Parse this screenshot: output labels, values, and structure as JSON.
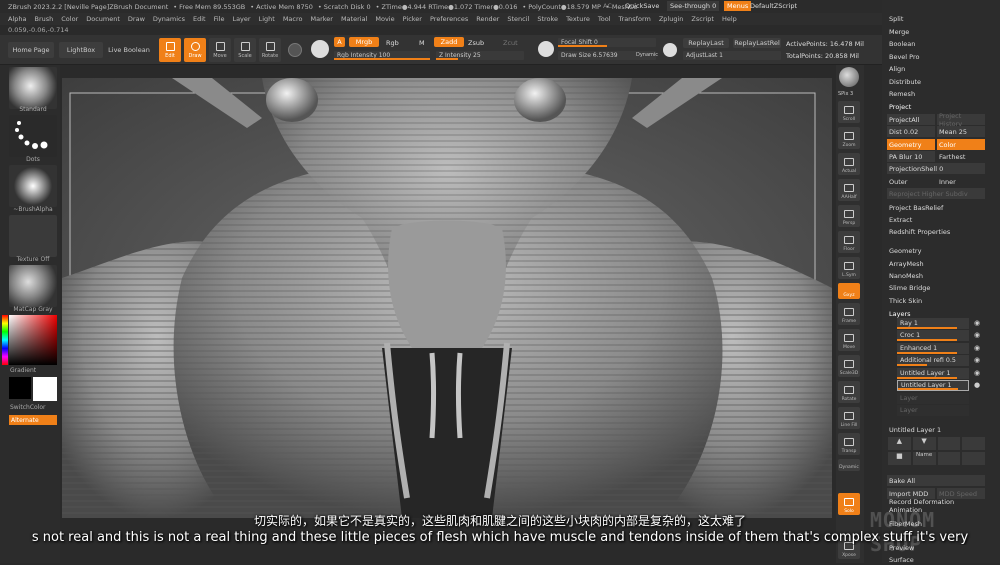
{
  "titlebar": {
    "items": [
      "ZBrush 2023.2.2 [Neville Page]ZBrush Document",
      "• Free Mem 89.553GB",
      "• Active Mem 8750",
      "• Scratch Disk 0",
      "• ZTime●4.944 RTime●1.072 Timer●0.016",
      "• PolyCount●18.579 MP",
      "• MeshCo"
    ],
    "ac": "AC",
    "quicksave": "QuickSave",
    "seethrough": "See-through",
    "seethrough_val": "0",
    "menus": "Menus",
    "script": "DefaultZScript"
  },
  "menubar": [
    "Alpha",
    "Brush",
    "Color",
    "Document",
    "Draw",
    "Dynamics",
    "Edit",
    "File",
    "Layer",
    "Light",
    "Macro",
    "Marker",
    "Material",
    "Movie",
    "Picker",
    "Preferences",
    "Render",
    "Stencil",
    "Stroke",
    "Texture",
    "Tool",
    "Transform",
    "Zplugin",
    "Zscript",
    "Help"
  ],
  "coords": "0.059,-0.06,-0.714",
  "toolbar": {
    "home": "Home Page",
    "lightbox": "LightBox",
    "liveboolean": "Live Boolean",
    "edit": "Edit",
    "draw": "Draw",
    "move": "Move",
    "scale": "Scale",
    "rotate": "Rotate",
    "a": "A",
    "mrgb": "Mrgb",
    "rgb": "Rgb",
    "m": "M",
    "zadd": "Zadd",
    "zsub": "Zsub",
    "zcut": "Zcut",
    "rgb_int": "Rgb Intensity 100",
    "z_int": "Z Intensity 25",
    "focal": "Focal Shift 0",
    "drawsize": "Draw Size 6.57639",
    "dynamic": "Dynamic",
    "replaylast": "ReplayLast",
    "replaylastrel": "ReplayLastRel",
    "adjustlast": "AdjustLast 1",
    "activepoints": "ActivePoints: 16.478 Mil",
    "totalpoints": "TotalPoints: 20.858 Mil"
  },
  "leftpanel": {
    "standard": "Standard",
    "dots": "Dots",
    "brushalpha": "~BrushAlpha",
    "textureoff": "Texture Off",
    "matcap": "MatCap Gray",
    "gradient": "Gradient",
    "switchcolor": "SwitchColor",
    "alternate": "Alternate"
  },
  "shelf": [
    "SPix 3",
    "Scroll",
    "Zoom",
    "Actual",
    "AAHalf",
    "Persp",
    "Floor",
    "L.Sym",
    "Gxyz",
    "Frame",
    "Move",
    "Scale3D",
    "Rotate",
    "Line Fill",
    "Transp",
    "Dynamic",
    "Solo",
    "Xpose"
  ],
  "tray": {
    "top": [
      "Split",
      "Merge",
      "Boolean",
      "Bevel Pro",
      "Align",
      "Distribute",
      "Remesh"
    ],
    "project": "Project",
    "projectall": "ProjectAll",
    "projecthistory": "Project History",
    "dist": "Dist 0.02",
    "mean": "Mean 25",
    "geometry": "Geometry",
    "color": "Color",
    "pablur": "PA Blur 10",
    "farthest": "Farthest",
    "projshell": "ProjectionShell 0",
    "outer": "Outer",
    "inner": "Inner",
    "reproject": "Reproject Higher Subdiv",
    "basrelief": "Project BasRelief",
    "extract": "Extract",
    "redshift": "Redshift Properties",
    "subs": [
      "Geometry",
      "ArrayMesh",
      "NanoMesh",
      "Slime Bridge",
      "Thick Skin"
    ],
    "layers_title": "Layers",
    "layers": [
      "Ray 1",
      "Croc 1",
      "Enhanced 1",
      "Additional refi 0.5",
      "Untitled Layer 1",
      "Untitled Layer 1",
      "Layer",
      "Layer"
    ],
    "untitled_bottom": "Untitled Layer 1",
    "name": "Name",
    "bakeall": "Bake All",
    "importmdd": "Import MDD",
    "mddspeed": "MDD Speed",
    "recordanim": "Record Deformation Animation",
    "fibermesh": "FiberMesh",
    "preview": "Preview",
    "surface": "Surface"
  },
  "subtitles": {
    "cn": "切实际的，如果它不是真实的，这些肌肉和肌腱之间的这些小块肉的内部是复杂的，这太难了",
    "en": "s not real and this is not a real thing and these little pieces of flesh which have muscle and tendons inside of them that's complex stuff it's very"
  },
  "watermark": "MONOM SHOP",
  "colors": {
    "accent": "#f08018"
  }
}
